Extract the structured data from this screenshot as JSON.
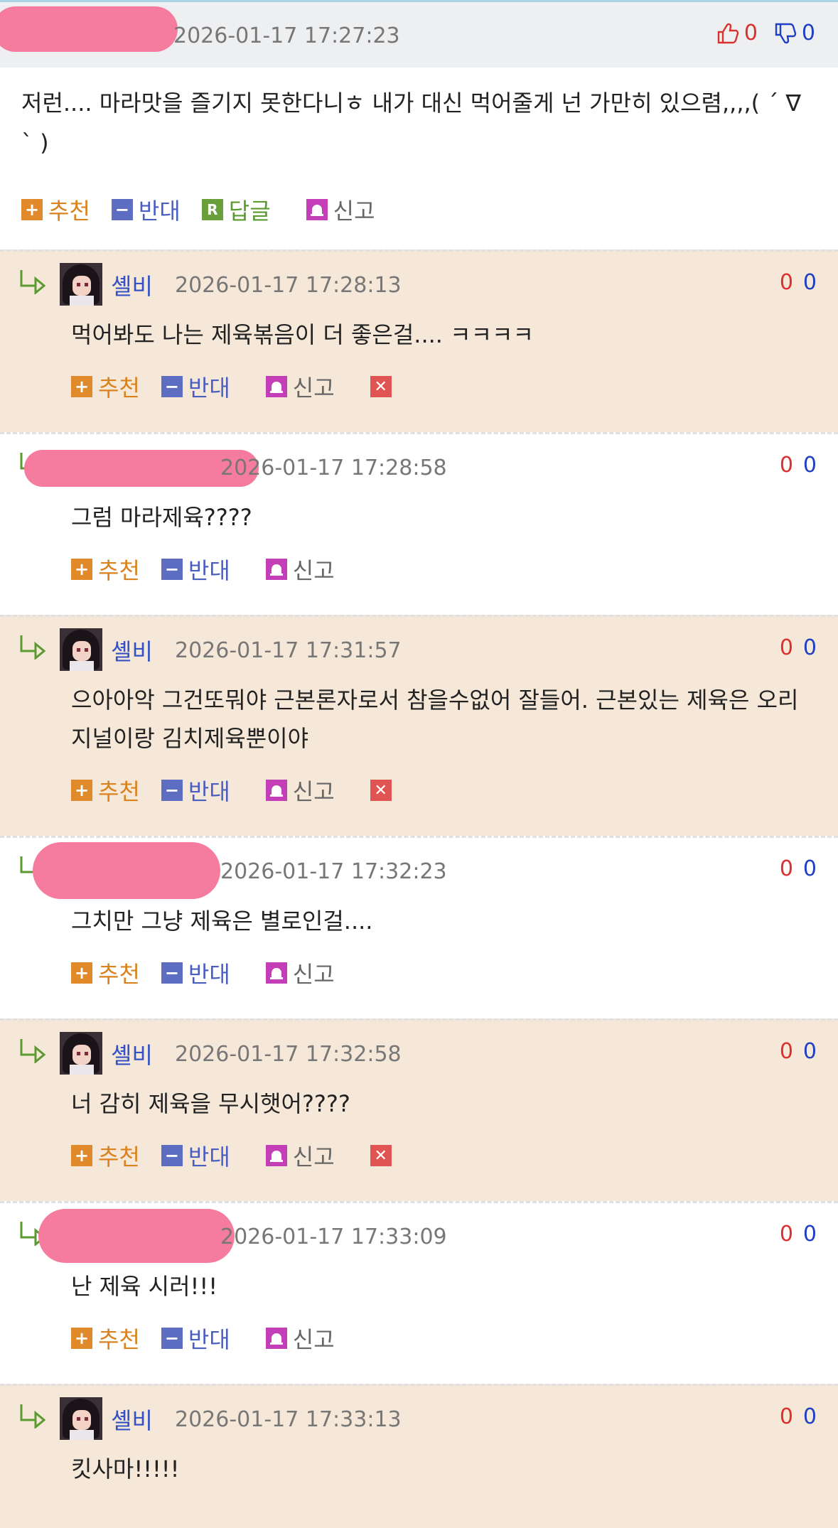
{
  "root": {
    "date": "2026-01-17 17:27:23",
    "up": "0",
    "down": "0",
    "body": "저런.... 마라맛을 즐기지 못한다니ㅎ 내가 대신 먹어줄게 넌 가만히 있으렴,,,,( ´ ∇ ` )",
    "actions": {
      "recommend": "추천",
      "oppose": "반대",
      "reply": "답글",
      "report": "신고"
    }
  },
  "labels": {
    "recommend": "추천",
    "oppose": "반대",
    "report": "신고"
  },
  "replies": [
    {
      "nick": "셸비",
      "date": "2026-01-17 17:28:13",
      "up": "0",
      "down": "0",
      "body": "먹어봐도 나는 제육볶음이 더 좋은걸.... ㅋㅋㅋㅋ"
    },
    {
      "nick": "",
      "date": "2026-01-17 17:28:58",
      "up": "0",
      "down": "0",
      "body": "그럼 마라제육????"
    },
    {
      "nick": "셸비",
      "date": "2026-01-17 17:31:57",
      "up": "0",
      "down": "0",
      "body": "으아아악 그건또뭐야 근본론자로서 참을수없어 잘들어. 근본있는 제육은 오리지널이랑 김치제육뿐이야"
    },
    {
      "nick": "",
      "date": "2026-01-17 17:32:23",
      "up": "0",
      "down": "0",
      "body": "그치만 그냥 제육은 별로인걸...."
    },
    {
      "nick": "셸비",
      "date": "2026-01-17 17:32:58",
      "up": "0",
      "down": "0",
      "body": "너 감히 제육을 무시햇어????"
    },
    {
      "nick": "",
      "date": "2026-01-17 17:33:09",
      "up": "0",
      "down": "0",
      "body": "난 제육 시러!!!"
    },
    {
      "nick": "셸비",
      "date": "2026-01-17 17:33:13",
      "up": "0",
      "down": "0",
      "body": "킷사마!!!!!"
    }
  ]
}
